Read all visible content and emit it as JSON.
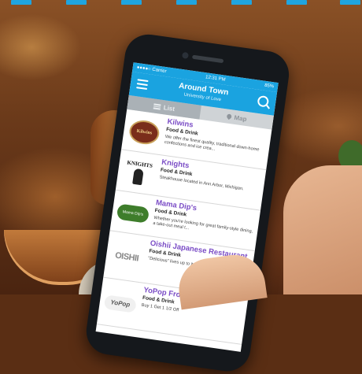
{
  "status_bar": {
    "carrier": "●●●●○ Carrier",
    "time": "12:31 PM",
    "battery": "85%"
  },
  "header": {
    "title": "Around Town",
    "subtitle": "University of Love"
  },
  "tabs": [
    {
      "label": "List",
      "icon": "list-icon",
      "active": true
    },
    {
      "label": "Map",
      "icon": "map-pin-icon",
      "active": false
    }
  ],
  "listings": [
    {
      "name": "Kilwins",
      "category": "Food & Drink",
      "description": "We offer the finest quality, traditional down-home confections and ice crea...",
      "logo_text": "Kilwins"
    },
    {
      "name": "Knights",
      "category": "Food & Drink",
      "description": "Steakhouse located in Ann Arbor, Michigan.",
      "logo_text": "KNIGHTS"
    },
    {
      "name": "Mama Dip's",
      "category": "Food & Drink",
      "description": "Whether you're looking for great family-style dining, a take-out meal t...",
      "logo_text": "Mama Dip's"
    },
    {
      "name": "Oishii Japanese Restaurant",
      "category": "Food & Drink",
      "description": "\"Delicious\" lives up to its name.",
      "logo_text": "OISHII"
    },
    {
      "name": "YoPop Frozen Yogurt",
      "category": "Food & Drink",
      "description": "Buy 1 Get 1 1/2 Off",
      "logo_text": "YoPop"
    }
  ],
  "colors": {
    "accent": "#1aa3e0",
    "listing_name": "#7b4dc6"
  }
}
